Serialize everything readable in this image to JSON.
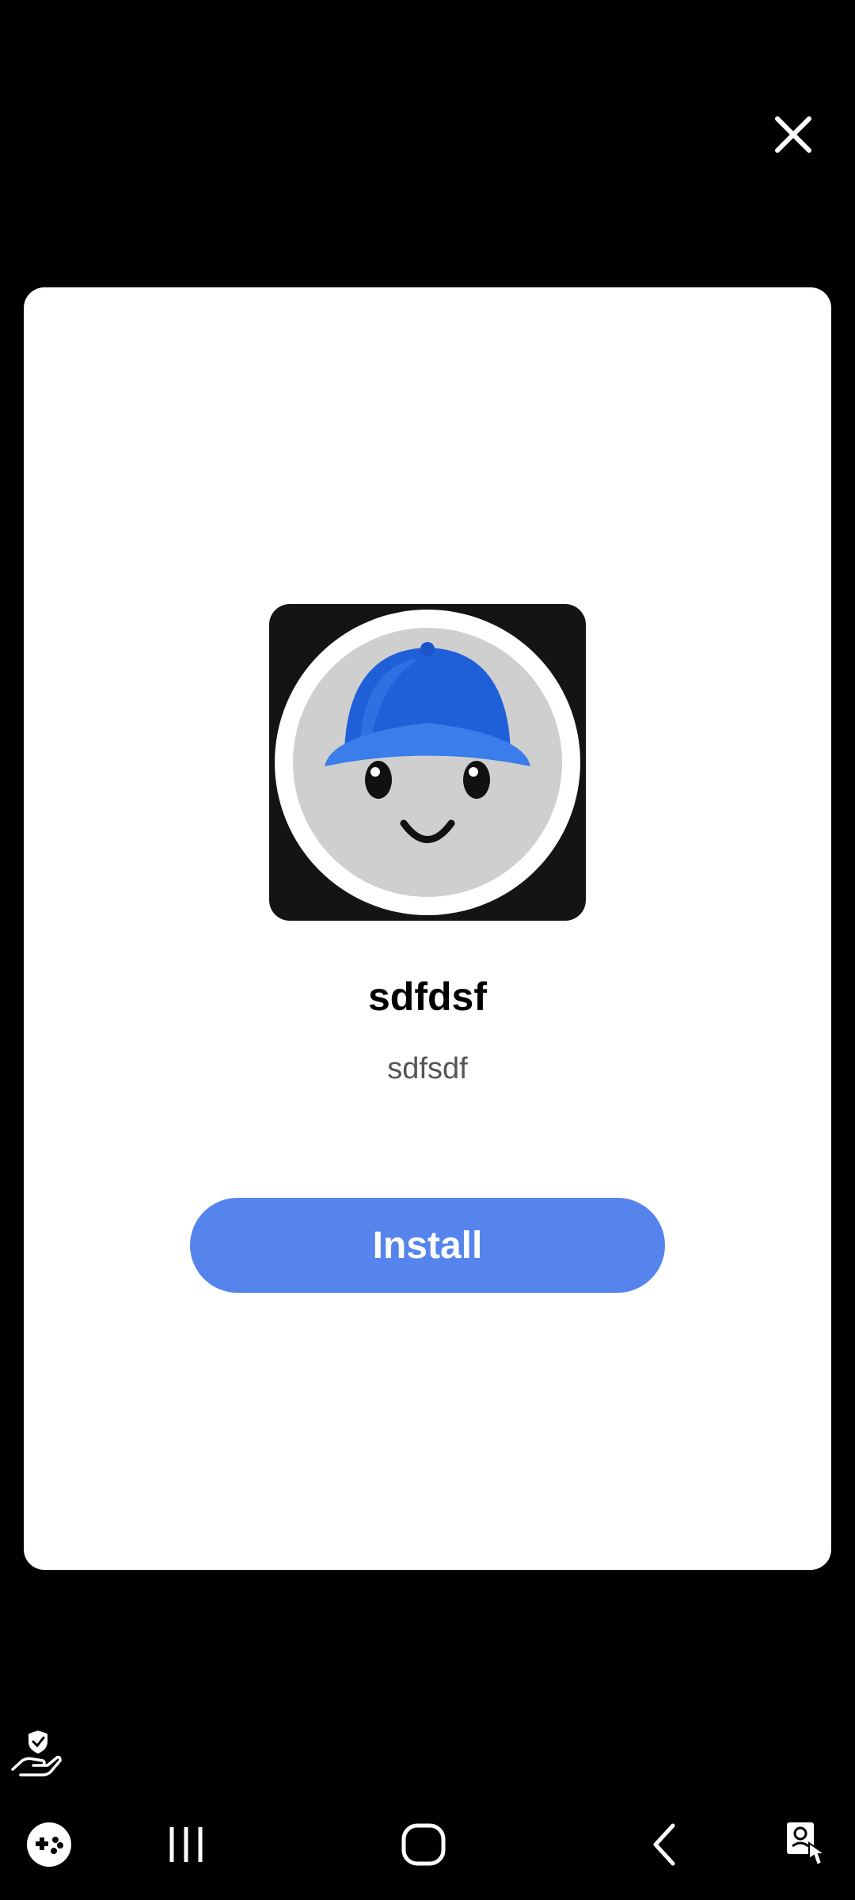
{
  "dialog": {
    "close_icon": "close-icon",
    "app_icon": "smiley-with-blue-cap-icon",
    "title": "sdfdsf",
    "subtitle": "sdfsdf",
    "install_label": "Install",
    "accent_color": "#5585EC"
  },
  "system": {
    "floating_icon": "hand-shield-icon",
    "nav": {
      "left_icon": "game-controller-icon",
      "recents_icon": "recents-icon",
      "home_icon": "home-icon",
      "back_icon": "back-icon",
      "right_icon": "accessibility-touch-icon"
    }
  }
}
